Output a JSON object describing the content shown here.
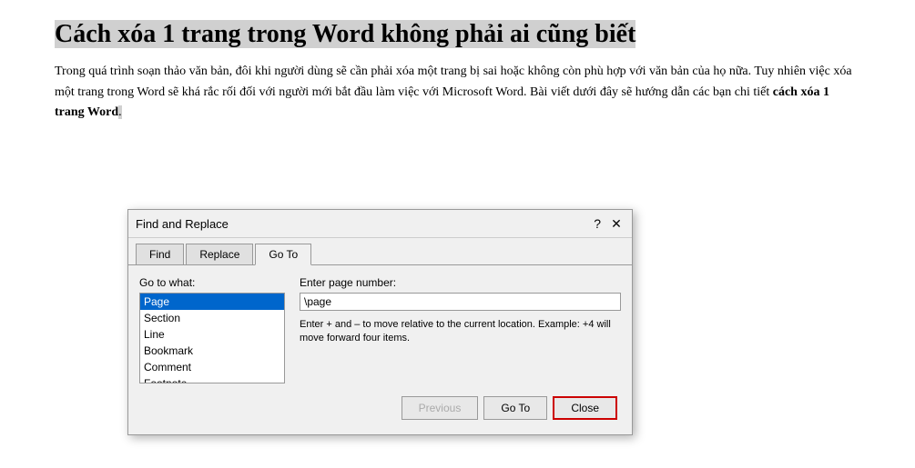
{
  "document": {
    "title": "Cách xóa 1 trang trong Word không phải ai cũng biết",
    "body_part1": "Trong quá trình soạn thảo văn bản, đôi khi người dùng sẽ cần phải xóa một trang bị sai hoặc không còn phù hợp với văn bản của họ nữa. Tuy nhiên việc xóa một trang trong Word sẽ khá rắc rối đối với người mới bắt đầu làm việc với Microsoft Word. Bài viết dưới đây sẽ hướng dẫn các bạn chi tiết ",
    "body_bold": "cách xóa 1 trang Word",
    "body_part2": "."
  },
  "dialog": {
    "title": "Find and Replace",
    "help_symbol": "?",
    "close_symbol": "✕",
    "tabs": [
      {
        "label": "Find",
        "active": false
      },
      {
        "label": "Replace",
        "active": false
      },
      {
        "label": "Go To",
        "active": true
      }
    ],
    "left_label": "Go to what:",
    "listbox_items": [
      {
        "label": "Page",
        "selected": true
      },
      {
        "label": "Section",
        "selected": false
      },
      {
        "label": "Line",
        "selected": false
      },
      {
        "label": "Bookmark",
        "selected": false
      },
      {
        "label": "Comment",
        "selected": false
      },
      {
        "label": "Footnote",
        "selected": false
      }
    ],
    "right_label": "Enter page number:",
    "input_value": "\\page",
    "hint": "Enter + and – to move relative to the current location. Example: +4 will move forward four items.",
    "buttons": {
      "previous": "Previous",
      "goto": "Go To",
      "close": "Close"
    }
  }
}
